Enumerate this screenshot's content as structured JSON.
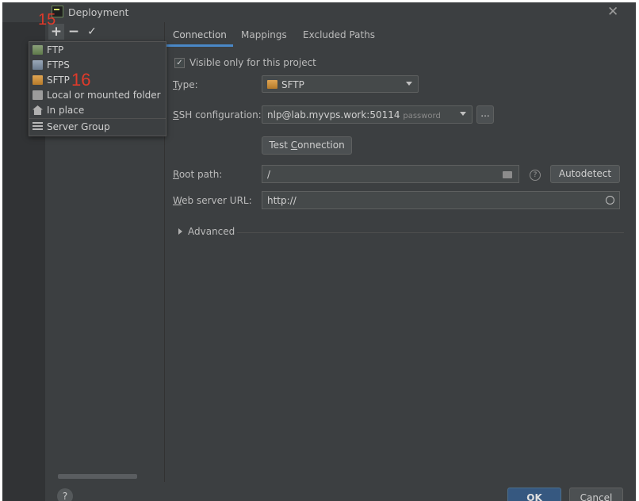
{
  "window": {
    "title": "Deployment",
    "close_glyph": "✕"
  },
  "left_toolbar": {
    "add": "+",
    "remove": "−",
    "apply": "✓"
  },
  "markers": {
    "step1": "15",
    "step2": "16"
  },
  "popup_menu": {
    "items": [
      {
        "label": "FTP",
        "icon": "ftp-server-icon"
      },
      {
        "label": "FTPS",
        "icon": "ftps-server-icon"
      },
      {
        "label": "SFTP",
        "icon": "sftp-server-icon"
      },
      {
        "label": "Local or mounted folder",
        "icon": "folder-icon"
      },
      {
        "label": "In place",
        "icon": "home-icon"
      },
      {
        "label": "Server Group",
        "icon": "server-group-icon"
      }
    ]
  },
  "tabs": [
    "Connection",
    "Mappings",
    "Excluded Paths"
  ],
  "visible_only": {
    "label": "Visible only for this project",
    "checked": true
  },
  "fields": {
    "type_label_first": "T",
    "type_label_rest": "ype:",
    "type_value": "SFTP",
    "ssh_label_first": "S",
    "ssh_label_rest": "SH configuration:",
    "ssh_value": "nlp@lab.myvps.work:50114",
    "ssh_hint": "password",
    "ssh_more": "...",
    "test_prefix": "Test ",
    "test_mnemonic": "C",
    "test_suffix": "onnection",
    "root_label_first": "R",
    "root_label_rest": "oot path:",
    "root_value": "/",
    "help": "?",
    "autodetect": "Autodetect",
    "web_label_first": "W",
    "web_label_rest": "eb server URL:",
    "web_value": "http://"
  },
  "advanced": {
    "label": "Advanced"
  },
  "footer": {
    "help": "?",
    "ok": "OK",
    "cancel": "Cancel"
  },
  "colors": {
    "background": "#3c3f41",
    "accent": "#4a88c7",
    "ok_button": "#365880",
    "marker": "#e03a2a"
  }
}
